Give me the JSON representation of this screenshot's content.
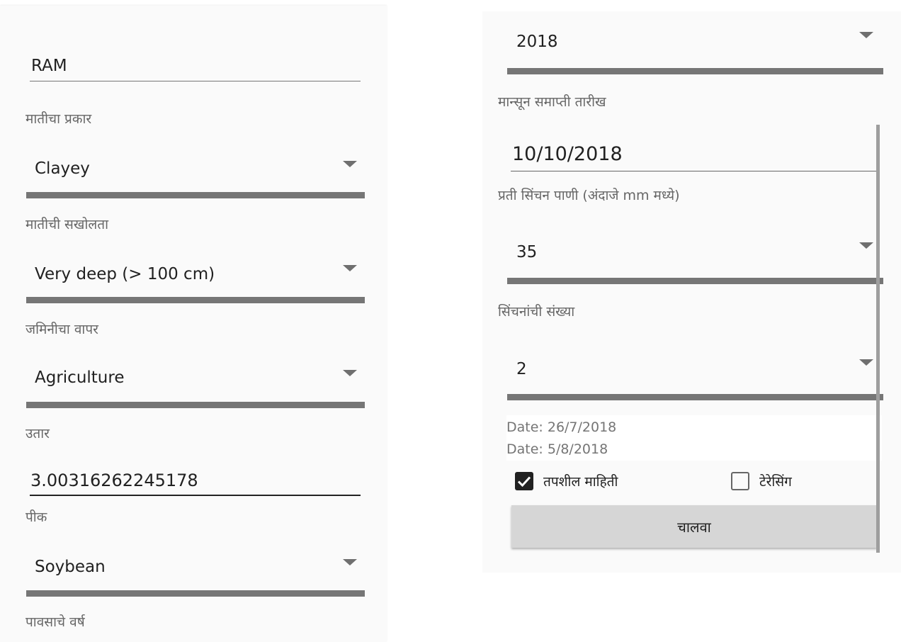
{
  "left": {
    "name_value": "RAM",
    "soil_type": {
      "label": "मातीचा प्रकार",
      "value": "Clayey"
    },
    "soil_depth": {
      "label": "मातीची सखोलता",
      "value": "Very deep (> 100 cm)"
    },
    "land_use": {
      "label": "जमिनीचा वापर",
      "value": "Agriculture"
    },
    "slope": {
      "label": "उतार",
      "value": "3.00316262245178"
    },
    "crop": {
      "label": "पीक",
      "value": "Soybean"
    },
    "rain_year": {
      "label": "पावसाचे वर्ष"
    }
  },
  "right": {
    "rain_year_value": "2018",
    "monsoon_end": {
      "label": "मान्सून समाप्ती तारीख",
      "value": "10/10/2018"
    },
    "water_per_irrigation": {
      "label": "प्रती सिंचन पाणी (अंदाजे mm मध्ये)",
      "value": "35"
    },
    "irrigation_count": {
      "label": "सिंचनांची संख्या",
      "value": "2"
    },
    "dates": [
      "Date: 26/7/2018",
      "Date: 5/8/2018"
    ],
    "detailed_info": {
      "label": "तपशील माहिती",
      "checked": true
    },
    "terracing": {
      "label": "टेरेसिंग",
      "checked": false
    },
    "run_label": "चालवा"
  },
  "colors": {
    "spinner_bar": "#767676",
    "button_bg": "#d6d6d6",
    "label_text": "#666666"
  }
}
